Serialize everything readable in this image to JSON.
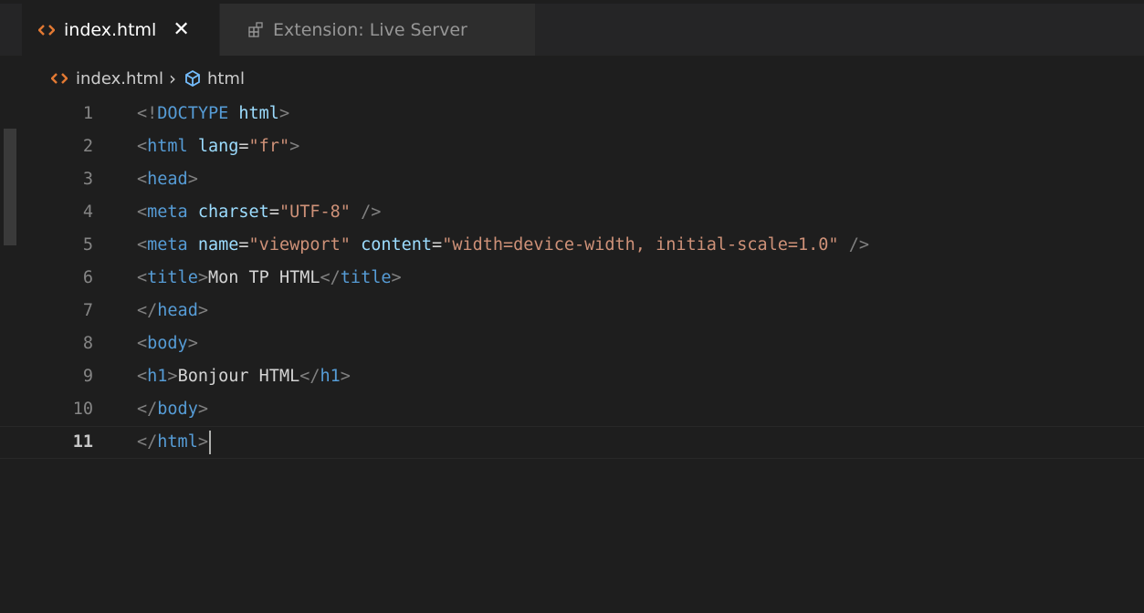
{
  "tabs": [
    {
      "label": "index.html",
      "active": true,
      "icon": "html-file-icon",
      "close": "✕"
    },
    {
      "label": "Extension: Live Server",
      "active": false,
      "icon": "extensions-icon"
    }
  ],
  "breadcrumb": {
    "file": "index.html",
    "separator": "›",
    "symbol": "html"
  },
  "editor": {
    "line_numbers": [
      "1",
      "2",
      "3",
      "4",
      "5",
      "6",
      "7",
      "8",
      "9",
      "10",
      "11"
    ],
    "current_line": 11,
    "lines": [
      [
        [
          "p",
          "<!"
        ],
        [
          "t",
          "DOCTYPE "
        ],
        [
          "a",
          "html"
        ],
        [
          "p",
          ">"
        ]
      ],
      [
        [
          "p",
          "<"
        ],
        [
          "t",
          "html "
        ],
        [
          "a",
          "lang"
        ],
        [
          "x",
          "="
        ],
        [
          "s",
          "\"fr\""
        ],
        [
          "p",
          ">"
        ]
      ],
      [
        [
          "p",
          "<"
        ],
        [
          "t",
          "head"
        ],
        [
          "p",
          ">"
        ]
      ],
      [
        [
          "p",
          "<"
        ],
        [
          "t",
          "meta "
        ],
        [
          "a",
          "charset"
        ],
        [
          "x",
          "="
        ],
        [
          "s",
          "\"UTF-8\""
        ],
        [
          "x",
          " "
        ],
        [
          "p",
          "/>"
        ]
      ],
      [
        [
          "p",
          "<"
        ],
        [
          "t",
          "meta "
        ],
        [
          "a",
          "name"
        ],
        [
          "x",
          "="
        ],
        [
          "s",
          "\"viewport\""
        ],
        [
          "x",
          " "
        ],
        [
          "a",
          "content"
        ],
        [
          "x",
          "="
        ],
        [
          "s",
          "\"width=device-width, initial-scale=1.0\""
        ],
        [
          "x",
          " "
        ],
        [
          "p",
          "/>"
        ]
      ],
      [
        [
          "p",
          "<"
        ],
        [
          "t",
          "title"
        ],
        [
          "p",
          ">"
        ],
        [
          "x",
          "Mon TP HTML"
        ],
        [
          "p",
          "</"
        ],
        [
          "t",
          "title"
        ],
        [
          "p",
          ">"
        ]
      ],
      [
        [
          "p",
          "</"
        ],
        [
          "t",
          "head"
        ],
        [
          "p",
          ">"
        ]
      ],
      [
        [
          "p",
          "<"
        ],
        [
          "t",
          "body"
        ],
        [
          "p",
          ">"
        ]
      ],
      [
        [
          "p",
          "<"
        ],
        [
          "t",
          "h1"
        ],
        [
          "p",
          ">"
        ],
        [
          "x",
          "Bonjour HTML"
        ],
        [
          "p",
          "</"
        ],
        [
          "t",
          "h1"
        ],
        [
          "p",
          ">"
        ]
      ],
      [
        [
          "p",
          "</"
        ],
        [
          "t",
          "body"
        ],
        [
          "p",
          ">"
        ]
      ],
      [
        [
          "p",
          "</"
        ],
        [
          "t",
          "html"
        ],
        [
          "p",
          ">"
        ]
      ]
    ]
  }
}
